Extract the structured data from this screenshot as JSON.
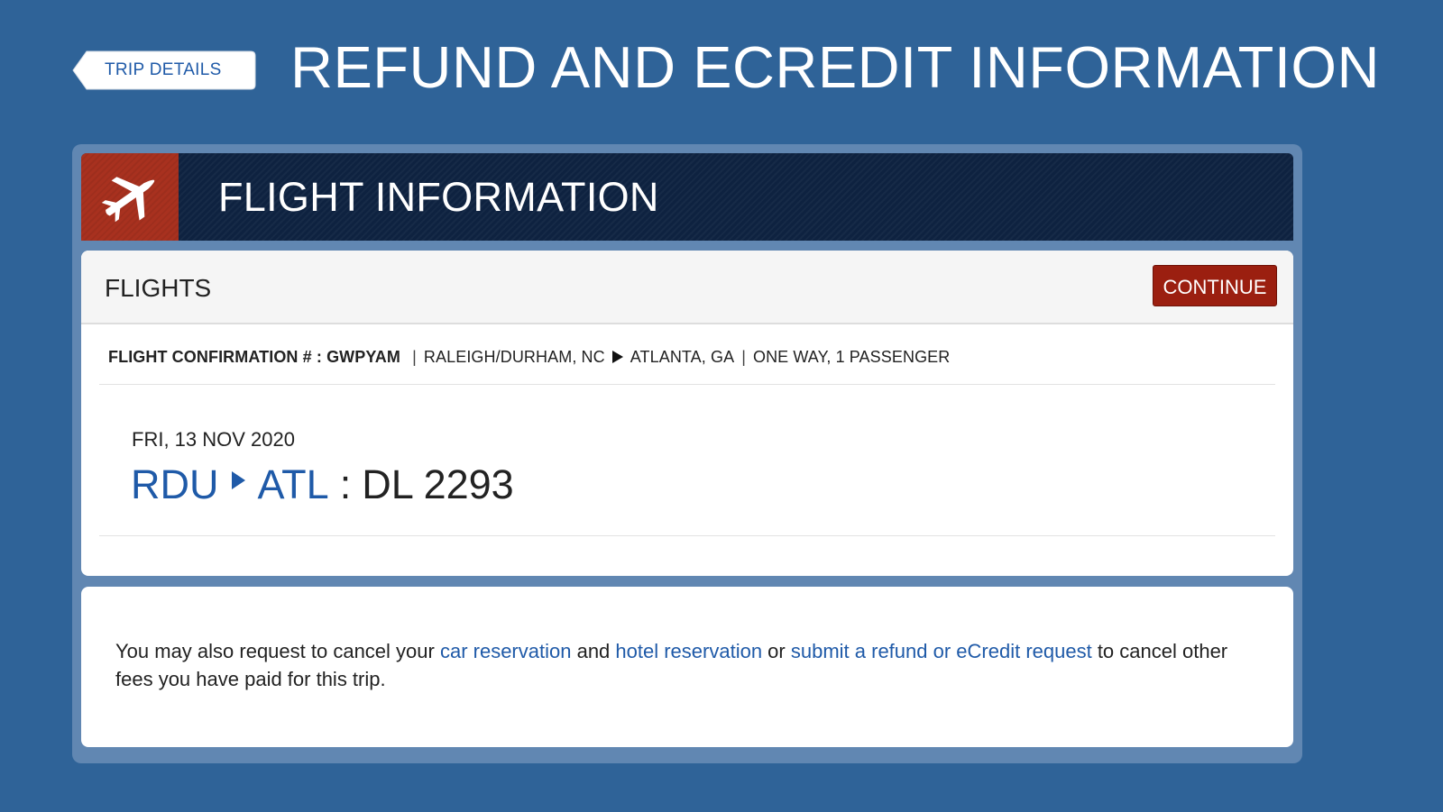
{
  "header": {
    "back_label": "TRIP DETAILS",
    "title": "REFUND AND ECREDIT INFORMATION"
  },
  "flight_panel": {
    "title": "FLIGHT INFORMATION",
    "icon": "airplane-icon"
  },
  "flights": {
    "section_title": "FLIGHTS",
    "continue_label": "CONTINUE",
    "confirmation_label": "FLIGHT CONFIRMATION # :",
    "confirmation_code": "GWPYAM",
    "origin_city": "RALEIGH/DURHAM, NC",
    "destination_city": "ATLANTA, GA",
    "trip_summary": "ONE WAY, 1 PASSENGER",
    "segments": [
      {
        "date": "FRI, 13 NOV 2020",
        "origin": "RDU",
        "destination": "ATL",
        "flight_number": "DL 2293"
      }
    ]
  },
  "note": {
    "text_1": "You may also request to cancel your ",
    "link_car": "car reservation",
    "text_2": " and ",
    "link_hotel": "hotel reservation",
    "text_3": " or ",
    "link_refund": "submit a refund or eCredit request",
    "text_4": " to cancel other fees you have paid for this trip."
  },
  "colors": {
    "page_background": "#2f6398",
    "header_navy": "#0e2240",
    "icon_red": "#a8311f",
    "continue_red": "#9b1f10",
    "link_blue": "#1f5aa8"
  }
}
